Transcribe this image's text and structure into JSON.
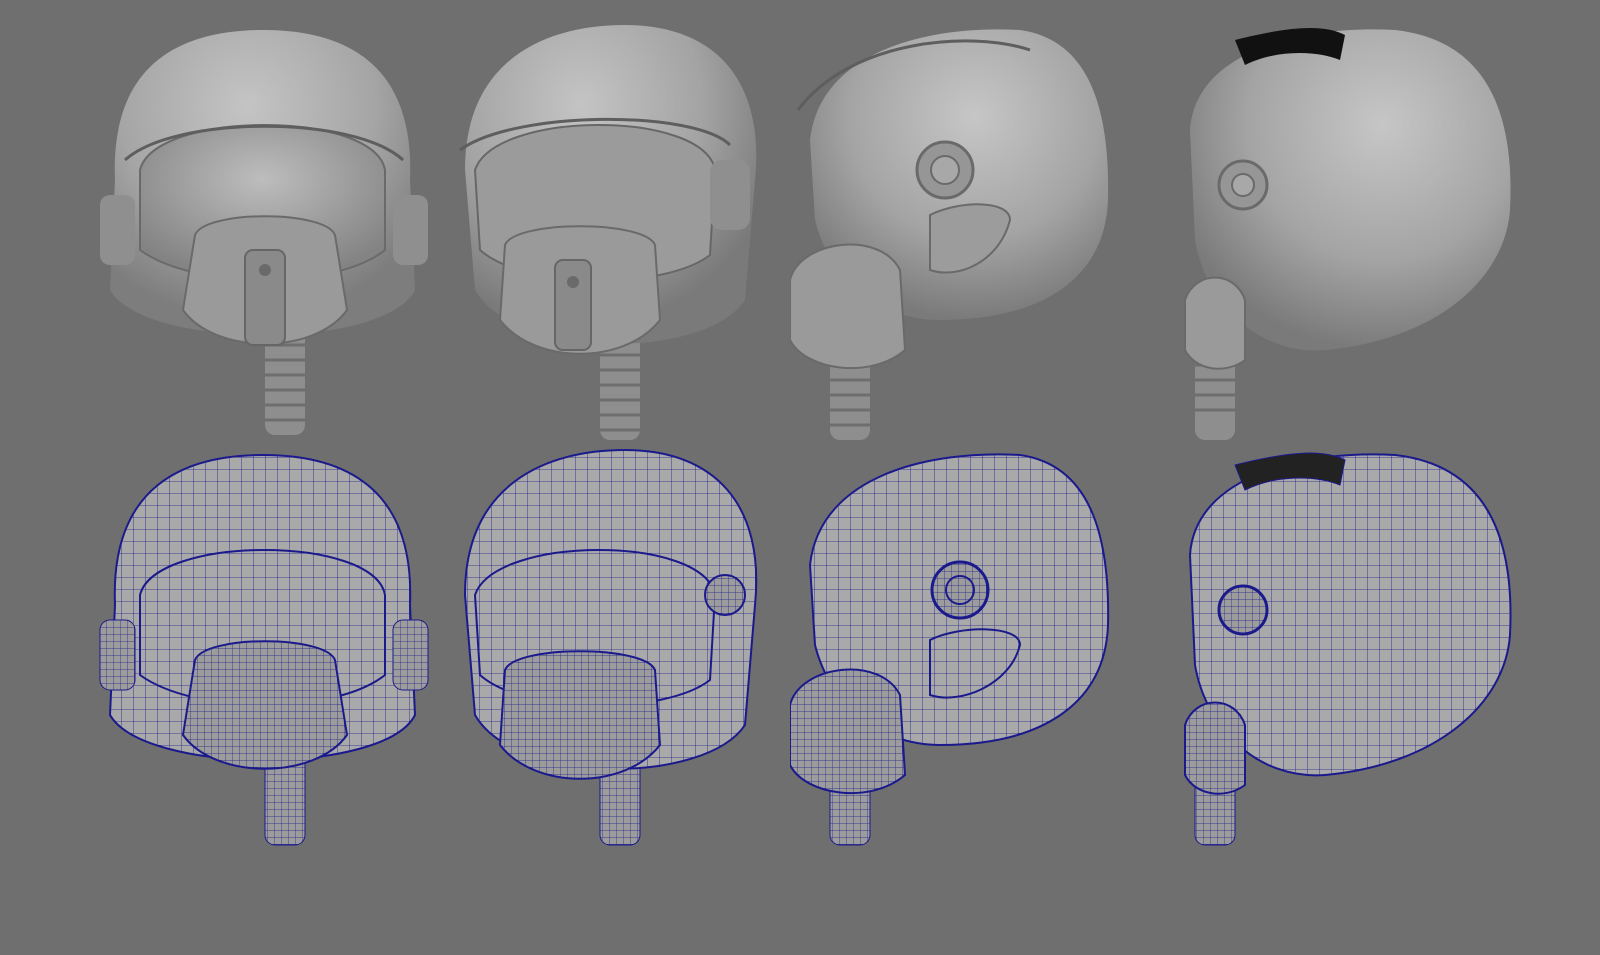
{
  "scene": {
    "background_color": "#6f6f6f",
    "shaded_color": "#a9a9a9",
    "shadow_color": "#5e5e5e",
    "wire_color": "#1b1a8c"
  },
  "rows": [
    {
      "id": "shaded",
      "style": "smooth-shaded",
      "views": [
        "front",
        "three-quarter",
        "side",
        "rear-three-quarter"
      ]
    },
    {
      "id": "wireframe",
      "style": "wireframe-on-shaded",
      "views": [
        "front",
        "three-quarter",
        "side",
        "rear-three-quarter"
      ]
    }
  ]
}
